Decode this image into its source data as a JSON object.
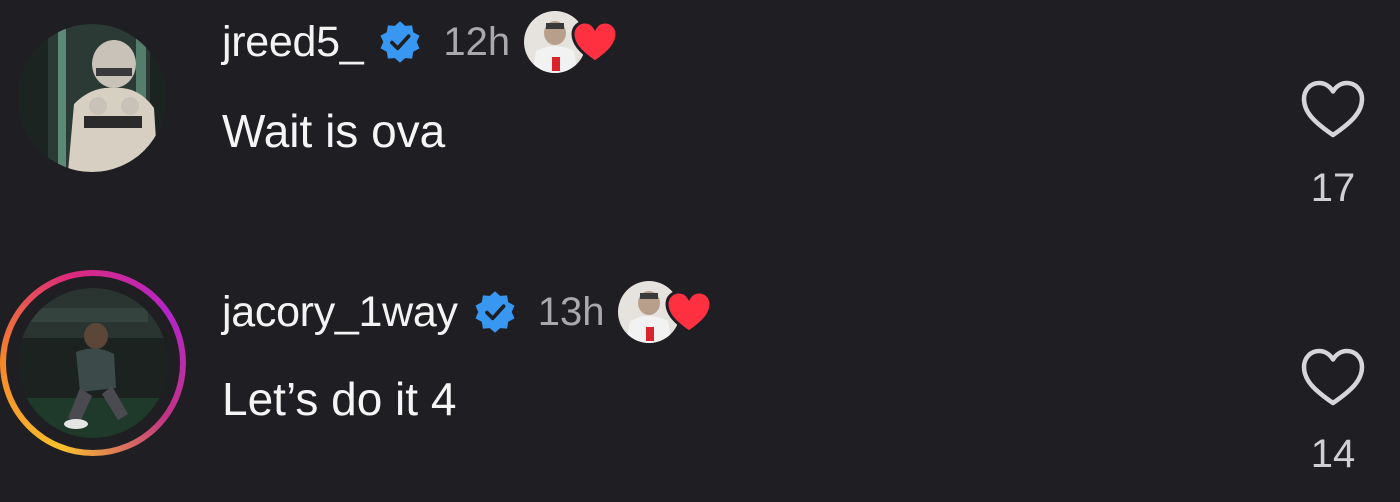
{
  "comments": [
    {
      "username": "jreed5_",
      "verified": true,
      "time": "12h",
      "text": "Wait is ova",
      "likes": "17",
      "liked_by_creator": true,
      "avatar_icon": "football-player-avatar",
      "avatar_ring": false
    },
    {
      "username": "jacory_1way",
      "verified": true,
      "time": "13h",
      "text": "Let’s do it 4",
      "likes": "14",
      "liked_by_creator": true,
      "avatar_icon": "player-crouching-avatar",
      "avatar_ring": true
    }
  ],
  "colors": {
    "background": "#1f1e23",
    "verified_blue": "#3897f0",
    "heart_red": "#ff3040",
    "muted_text": "#a8a8ad"
  }
}
